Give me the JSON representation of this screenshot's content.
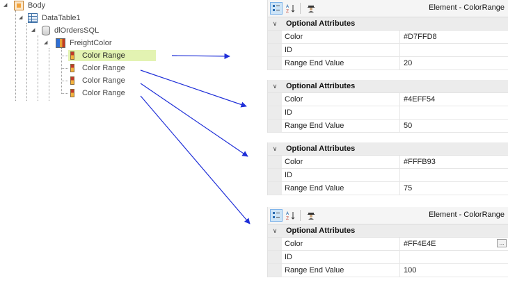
{
  "tree": {
    "body": "Body",
    "datatable": "DataTable1",
    "datalayer": "dlOrdersSQL",
    "freightcolor": "FreightColor",
    "ranges": [
      "Color Range",
      "Color Range",
      "Color Range",
      "Color Range"
    ]
  },
  "panel_title": "Element - ColorRange",
  "category": "Optional Attributes",
  "labels": {
    "color": "Color",
    "id": "ID",
    "range_end": "Range End Value"
  },
  "panels": [
    {
      "color": "#D7FFD8",
      "id": "",
      "range_end": "20"
    },
    {
      "color": "#4EFF54",
      "id": "",
      "range_end": "50"
    },
    {
      "color": "#FFFB93",
      "id": "",
      "range_end": "75"
    },
    {
      "color": "#FF4E4E",
      "id": "",
      "range_end": "100"
    }
  ],
  "ellipsis": "...",
  "icons": {
    "categorized": "categorized-view-icon",
    "alphabetical": "alphabetical-sort-icon",
    "agent": "agent-icon",
    "chevron": "chevron-down-icon"
  },
  "arrow_color": "#1f2fd8",
  "selection_color": "#e3f3b2"
}
